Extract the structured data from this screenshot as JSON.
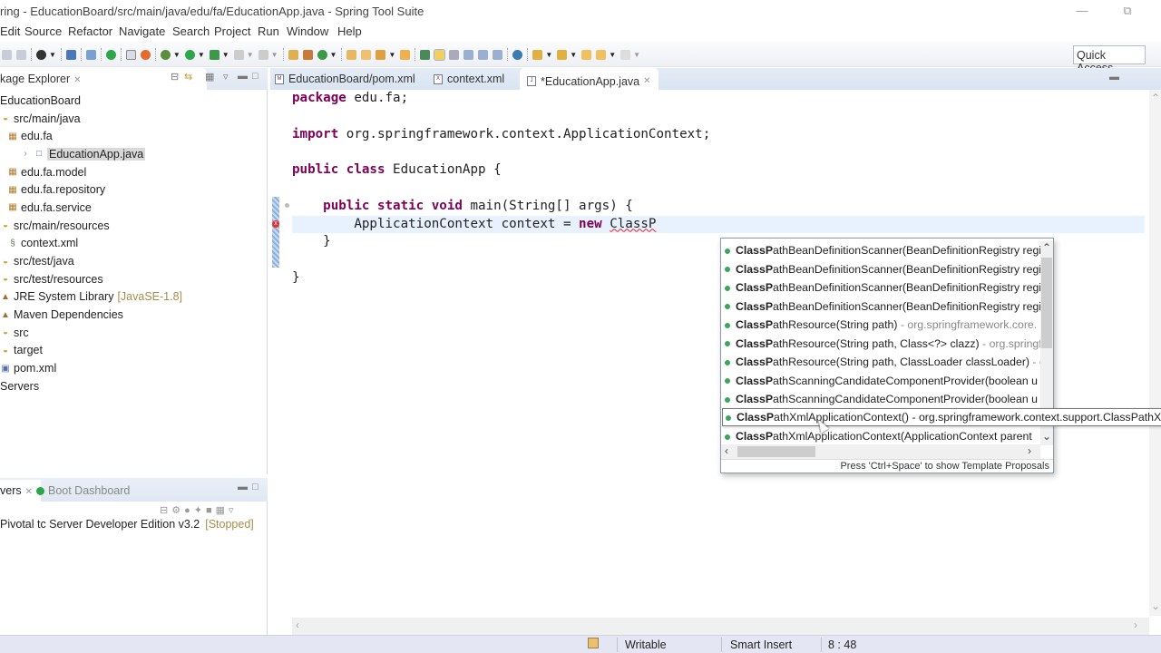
{
  "window": {
    "title": "ring - EducationBoard/src/main/java/edu/fa/EducationApp.java - Spring Tool Suite",
    "minimize_icon": "minimize-icon",
    "restore_icon": "restore-icon"
  },
  "menu": [
    "Edit",
    "Source",
    "Refactor",
    "Navigate",
    "Search",
    "Project",
    "Run",
    "Window",
    "Help"
  ],
  "toolbar": {
    "quick_access": "Quick Access"
  },
  "package_explorer": {
    "tab_label": "kage Explorer",
    "tree": [
      {
        "label": "EducationBoard",
        "icon": "project-icon",
        "indent": 0
      },
      {
        "label": "src/main/java",
        "icon": "source-folder-icon",
        "indent": 1
      },
      {
        "label": "edu.fa",
        "icon": "package-icon",
        "indent": 2,
        "expanded": true
      },
      {
        "label": "EducationApp.java",
        "icon": "java-file-icon",
        "indent": 3,
        "selected": true
      },
      {
        "label": "edu.fa.model",
        "icon": "package-icon",
        "indent": 2
      },
      {
        "label": "edu.fa.repository",
        "icon": "package-icon",
        "indent": 2
      },
      {
        "label": "edu.fa.service",
        "icon": "package-icon",
        "indent": 2
      },
      {
        "label": "src/main/resources",
        "icon": "source-folder-icon",
        "indent": 1
      },
      {
        "label": "context.xml",
        "icon": "spring-xml-icon",
        "indent": 2
      },
      {
        "label": "src/test/java",
        "icon": "source-folder-icon",
        "indent": 1
      },
      {
        "label": "src/test/resources",
        "icon": "source-folder-icon",
        "indent": 1
      },
      {
        "label": "JRE System Library",
        "decoration": "[JavaSE-1.8]",
        "icon": "library-icon",
        "indent": 1
      },
      {
        "label": "Maven Dependencies",
        "icon": "library-icon",
        "indent": 1
      },
      {
        "label": "src",
        "icon": "folder-icon",
        "indent": 1
      },
      {
        "label": "target",
        "icon": "folder-icon",
        "indent": 1
      },
      {
        "label": "pom.xml",
        "icon": "xml-file-icon",
        "indent": 1
      },
      {
        "label": "Servers",
        "icon": "project-icon",
        "indent": 0
      }
    ]
  },
  "servers_panel": {
    "tabs": [
      "vers",
      "Boot Dashboard"
    ],
    "server_name": "Pivotal tc Server Developer Edition v3.2",
    "server_state": "[Stopped]"
  },
  "editor": {
    "tabs": [
      {
        "label": "EducationBoard/pom.xml",
        "icon": "maven-file-icon",
        "active": false
      },
      {
        "label": "context.xml",
        "icon": "spring-xml-icon",
        "active": false
      },
      {
        "label": "*EducationApp.java",
        "icon": "java-file-icon",
        "active": true
      }
    ],
    "code_lines": [
      [
        {
          "t": "package",
          "k": true
        },
        {
          "t": " edu.fa;"
        }
      ],
      [],
      [
        {
          "t": "import",
          "k": true
        },
        {
          "t": " org.springframework.context.ApplicationContext;"
        }
      ],
      [],
      [
        {
          "t": "public",
          "k": true
        },
        {
          "t": " "
        },
        {
          "t": "class",
          "k": true
        },
        {
          "t": " EducationApp {"
        }
      ],
      [],
      [
        {
          "t": "    "
        },
        {
          "t": "public",
          "k": true
        },
        {
          "t": " "
        },
        {
          "t": "static",
          "k": true
        },
        {
          "t": " "
        },
        {
          "t": "void",
          "k": true
        },
        {
          "t": " main(String[] args) {"
        }
      ],
      [
        {
          "t": "        ApplicationContext context = "
        },
        {
          "t": "new",
          "k": true
        },
        {
          "t": " "
        },
        {
          "t": "ClassP",
          "err": true
        }
      ],
      [
        {
          "t": "    }"
        }
      ],
      [],
      [
        {
          "t": "}"
        }
      ]
    ]
  },
  "content_assist": {
    "prefix": "ClassP",
    "proposals": [
      {
        "rest": "athBeanDefinitionScanner(BeanDefinitionRegistry regi",
        "qual": ""
      },
      {
        "rest": "athBeanDefinitionScanner(BeanDefinitionRegistry regi",
        "qual": ""
      },
      {
        "rest": "athBeanDefinitionScanner(BeanDefinitionRegistry regi",
        "qual": ""
      },
      {
        "rest": "athBeanDefinitionScanner(BeanDefinitionRegistry regi",
        "qual": ""
      },
      {
        "rest": "athResource(String path)",
        "qual": " - org.springframework.core."
      },
      {
        "rest": "athResource(String path, Class<?> clazz)",
        "qual": " - org.springf"
      },
      {
        "rest": "athResource(String path, ClassLoader classLoader)",
        "qual": " - o"
      },
      {
        "rest": "athScanningCandidateComponentProvider(boolean u",
        "qual": ""
      },
      {
        "rest": "athScanningCandidateComponentProvider(boolean u",
        "qual": ""
      },
      {
        "rest": "athXmlApplicationContext()",
        "qual": " - org.springframework.context.support.ClassPathX"
      },
      {
        "rest": "athXmlApplicationContext(ApplicationContext parent",
        "qual": ""
      }
    ],
    "selected_index": 9,
    "footer": "Press 'Ctrl+Space' to show Template Proposals"
  },
  "statusbar": {
    "writable": "Writable",
    "insert_mode": "Smart Insert",
    "position": "8 : 48"
  }
}
